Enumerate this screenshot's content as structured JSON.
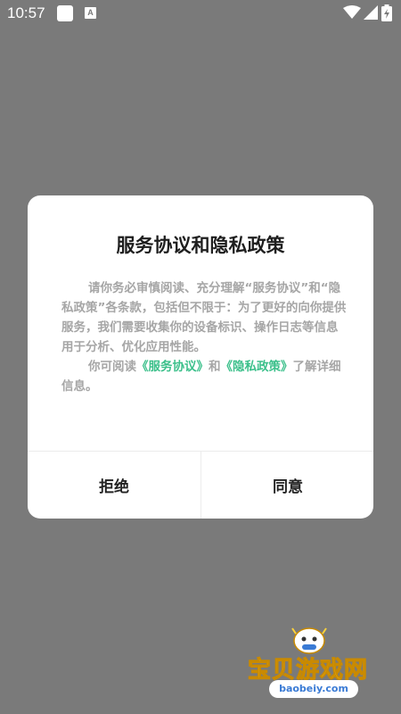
{
  "status_bar": {
    "time": "10:57",
    "icons": [
      "square-notification-icon",
      "a-notification-icon",
      "wifi-icon",
      "signal-icon",
      "battery-icon"
    ],
    "a_icon_letter": "A"
  },
  "dialog": {
    "title": "服务协议和隐私政策",
    "paragraph1": "请你务必审慎阅读、充分理解“服务协议”和“隐私政策”各条款，包括但不限于：为了更好的向你提供服务，我们需要收集你的设备标识、操作日志等信息用于分析、优化应用性能。",
    "paragraph2_prefix": "你可阅读",
    "link_service": "《服务协议》",
    "paragraph2_and": "和",
    "link_privacy": "《隐私政策》",
    "paragraph2_suffix": "了解详细信息。",
    "reject_label": "拒绝",
    "agree_label": "同意",
    "colors": {
      "link": "#3cc08b",
      "body_text": "#a6a6a6",
      "title": "#1e1e1e"
    }
  },
  "watermark": {
    "text": "宝贝游戏网",
    "url": "baobeiy.com"
  }
}
